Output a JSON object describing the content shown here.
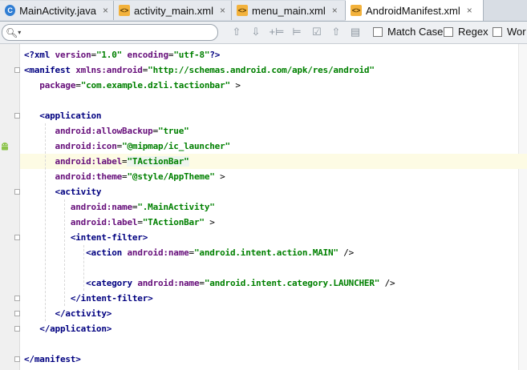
{
  "tabs": [
    {
      "label": "MainActivity.java",
      "icon": "java-class-icon",
      "active": false
    },
    {
      "label": "activity_main.xml",
      "icon": "xml-file-icon",
      "active": false
    },
    {
      "label": "menu_main.xml",
      "icon": "xml-file-icon",
      "active": false
    },
    {
      "label": "AndroidManifest.xml",
      "icon": "xml-file-icon",
      "active": true
    }
  ],
  "tab_close_glyph": "×",
  "search": {
    "value": "",
    "placeholder": ""
  },
  "find_options": [
    {
      "label": "Match Case"
    },
    {
      "label": "Regex"
    },
    {
      "label": "Wor"
    }
  ],
  "code": [
    {
      "indent": 0,
      "parts": [
        [
          "tg",
          "<?xml "
        ],
        [
          "at",
          "version"
        ],
        [
          "pl",
          "="
        ],
        [
          "vl",
          "\"1.0\""
        ],
        [
          "pl",
          " "
        ],
        [
          "at",
          "encoding"
        ],
        [
          "pl",
          "="
        ],
        [
          "vl",
          "\"utf-8\""
        ],
        [
          "tg",
          "?>"
        ]
      ]
    },
    {
      "indent": 0,
      "parts": [
        [
          "tg",
          "<manifest "
        ],
        [
          "at",
          "xmlns:android"
        ],
        [
          "pl",
          "="
        ],
        [
          "vl",
          "\"http://schemas.android.com/apk/res/android\""
        ]
      ]
    },
    {
      "indent": 3,
      "parts": [
        [
          "at",
          "package"
        ],
        [
          "pl",
          "="
        ],
        [
          "vl",
          "\"com.example.dzli.tactionbar\""
        ],
        [
          "pl",
          " >"
        ]
      ]
    },
    {
      "indent": 0,
      "parts": []
    },
    {
      "indent": 3,
      "parts": [
        [
          "tg",
          "<application"
        ]
      ]
    },
    {
      "indent": 6,
      "parts": [
        [
          "at",
          "android:allowBackup"
        ],
        [
          "pl",
          "="
        ],
        [
          "vl",
          "\"true\""
        ]
      ]
    },
    {
      "indent": 6,
      "parts": [
        [
          "at",
          "android:icon"
        ],
        [
          "pl",
          "="
        ],
        [
          "vl",
          "\"@mipmap/ic_launcher\""
        ]
      ]
    },
    {
      "indent": 6,
      "parts": [
        [
          "at",
          "android:label"
        ],
        [
          "pl",
          "="
        ],
        [
          "vl",
          "\"TActionBar\""
        ]
      ]
    },
    {
      "indent": 6,
      "parts": [
        [
          "at",
          "android:theme"
        ],
        [
          "pl",
          "="
        ],
        [
          "vl",
          "\"@style/AppTheme\""
        ],
        [
          "pl",
          " >"
        ]
      ]
    },
    {
      "indent": 6,
      "parts": [
        [
          "tg",
          "<activity"
        ]
      ]
    },
    {
      "indent": 9,
      "parts": [
        [
          "at",
          "android:name"
        ],
        [
          "pl",
          "="
        ],
        [
          "vl",
          "\".MainActivity\""
        ]
      ]
    },
    {
      "indent": 9,
      "parts": [
        [
          "at",
          "android:label"
        ],
        [
          "pl",
          "="
        ],
        [
          "vl",
          "\"TActionBar\""
        ],
        [
          "pl",
          " >"
        ]
      ]
    },
    {
      "indent": 9,
      "parts": [
        [
          "tg",
          "<intent-filter>"
        ]
      ]
    },
    {
      "indent": 12,
      "parts": [
        [
          "tg",
          "<action "
        ],
        [
          "at",
          "android:name"
        ],
        [
          "pl",
          "="
        ],
        [
          "vl",
          "\"android.intent.action.MAIN\""
        ],
        [
          "pl",
          " />"
        ]
      ]
    },
    {
      "indent": 0,
      "parts": []
    },
    {
      "indent": 12,
      "parts": [
        [
          "tg",
          "<category "
        ],
        [
          "at",
          "android:name"
        ],
        [
          "pl",
          "="
        ],
        [
          "vl",
          "\"android.intent.category.LAUNCHER\""
        ],
        [
          "pl",
          " />"
        ]
      ]
    },
    {
      "indent": 9,
      "parts": [
        [
          "tg",
          "</intent-filter>"
        ]
      ]
    },
    {
      "indent": 6,
      "parts": [
        [
          "tg",
          "</activity>"
        ]
      ]
    },
    {
      "indent": 3,
      "parts": [
        [
          "tg",
          "</application>"
        ]
      ]
    },
    {
      "indent": 0,
      "parts": []
    },
    {
      "indent": 0,
      "parts": [
        [
          "tg",
          "</manifest>"
        ]
      ]
    }
  ],
  "highlight_line": 7,
  "android_icon_line": 6,
  "colors": {
    "tag": "#000080",
    "attr": "#660e7a",
    "value": "#008000",
    "caret_line": "#fdfbe4"
  }
}
